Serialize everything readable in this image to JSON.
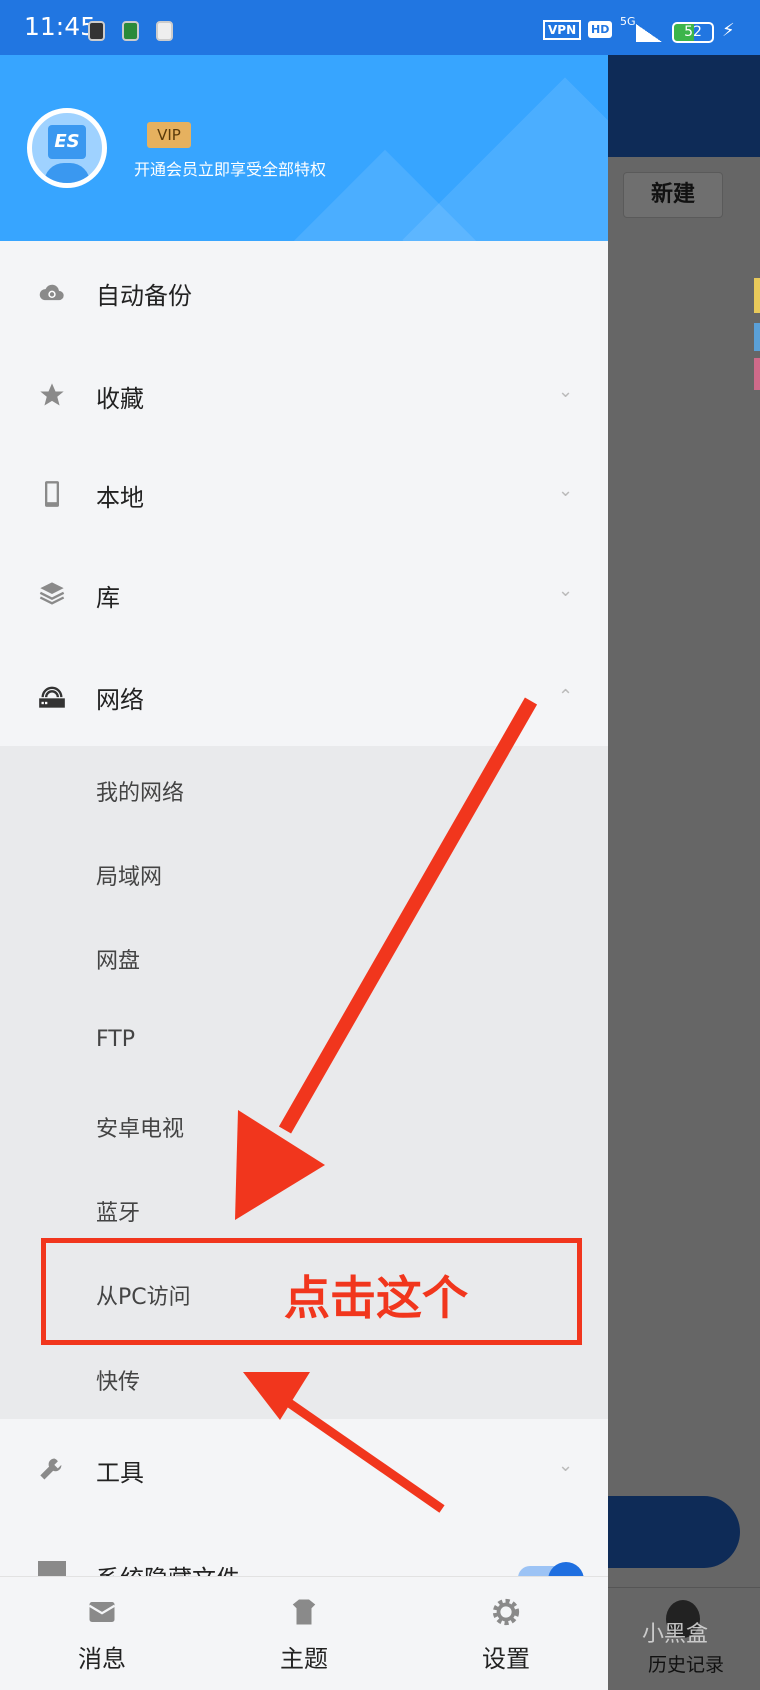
{
  "status_bar": {
    "time": "11:45",
    "vpn": "VPN",
    "hd": "HD",
    "network": "5G",
    "battery": "52"
  },
  "header": {
    "vip_badge": "VIP",
    "vip_subtitle": "开通会员立即享受全部特权",
    "avatar_logo": "ES"
  },
  "menu": [
    {
      "label": "自动备份",
      "icon": "cloud-sync-icon"
    },
    {
      "label": "收藏",
      "icon": "star-icon",
      "chevron": "down"
    },
    {
      "label": "本地",
      "icon": "phone-icon",
      "chevron": "down"
    },
    {
      "label": "库",
      "icon": "layers-icon",
      "chevron": "down"
    },
    {
      "label": "网络",
      "icon": "router-icon",
      "chevron": "up",
      "expanded": true
    }
  ],
  "network_submenu": [
    "我的网络",
    "局域网",
    "网盘",
    "FTP",
    "安卓电视",
    "蓝牙",
    "从PC访问",
    "快传"
  ],
  "tools": {
    "label": "工具",
    "icon": "wrench-icon"
  },
  "hidden_files": {
    "label": "系统隐藏文件",
    "toggle_on": true
  },
  "bottom_nav": [
    {
      "label": "消息",
      "icon": "mail-icon"
    },
    {
      "label": "主题",
      "icon": "shirt-icon"
    },
    {
      "label": "设置",
      "icon": "gear-icon"
    }
  ],
  "background": {
    "new_button": "新建",
    "history": "历史记录",
    "watermark": "小黑盒"
  },
  "annotation": {
    "text": "点击这个",
    "color": "#f1361d"
  },
  "colors": {
    "status_bar": "#2176e1",
    "header": "#37a5ff",
    "accent": "#1f6fe0"
  }
}
